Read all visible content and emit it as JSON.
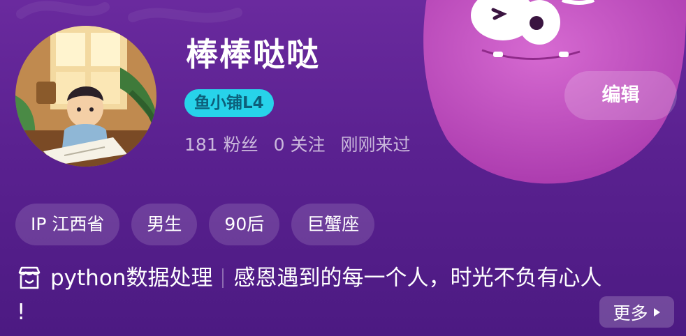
{
  "profile": {
    "username": "棒棒哒哒",
    "level_badge": "鱼小铺L4",
    "stats": {
      "followers": "181 粉丝",
      "following": "0 关注",
      "last_seen": "刚刚来过"
    }
  },
  "edit_label": "编辑",
  "tags": [
    "IP 江西省",
    "男生",
    "90后",
    "巨蟹座"
  ],
  "bio": {
    "title": "python数据处理",
    "text": "感恩遇到的每一个人，时光不负有心人",
    "overflow": "!"
  },
  "more_label": "更多",
  "colors": {
    "background": "#5a2190",
    "badge_bg": "#27d3ea",
    "badge_text": "#0d5f7a",
    "mascot": "#c24fc0"
  },
  "icons": {
    "bio": "store-icon",
    "more": "triangle-right-icon",
    "background": "monster-mascot-icon"
  }
}
